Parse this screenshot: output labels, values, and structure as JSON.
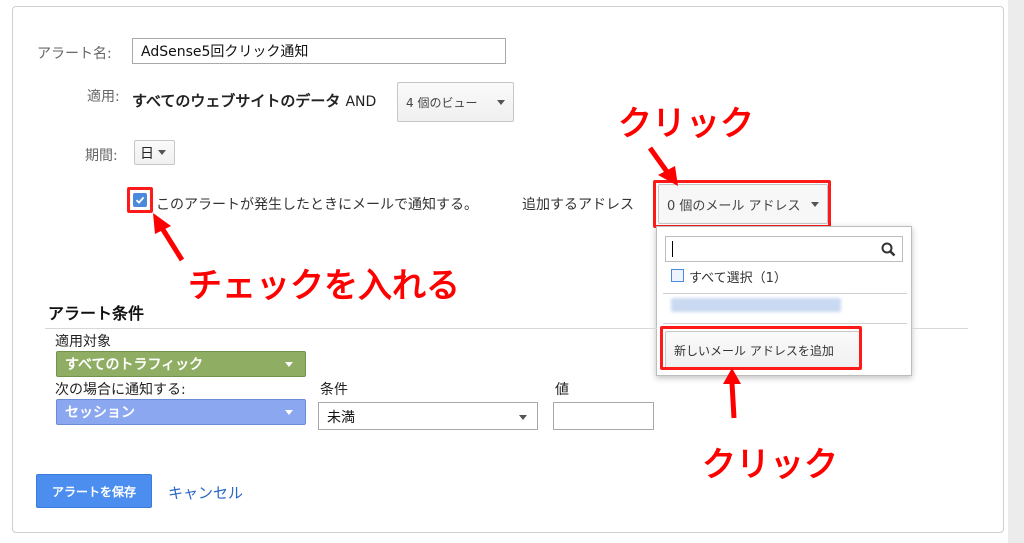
{
  "form": {
    "alert_name_label": "アラート名:",
    "alert_name_value": "AdSense5回クリック通知",
    "apply_label": "適用:",
    "apply_text": "すべてのウェブサイトのデータ",
    "apply_and": "AND",
    "views_button": "4 個のビュー",
    "period_label": "期間:",
    "period_value": "日",
    "email_checkbox_label": "このアラートが発生したときにメールで通知する。",
    "add_address_label": "追加するアドレス",
    "email_address_button": "0 個のメール アドレス"
  },
  "dropdown": {
    "select_all": "すべて選択（1）",
    "add_email_button": "新しいメール アドレスを追加"
  },
  "conditions": {
    "title": "アラート条件",
    "applies_to_label": "適用対象",
    "traffic_button": "すべてのトラフィック",
    "notify_when_label": "次の場合に通知する:",
    "session_button": "セッション",
    "condition_label": "条件",
    "condition_value": "未満",
    "value_label": "値"
  },
  "actions": {
    "save": "アラートを保存",
    "cancel": "キャンセル"
  },
  "annotations": {
    "click_top": "クリック",
    "check_instruction": "チェックを入れる",
    "click_bottom": "クリック"
  },
  "colors": {
    "annotation_red": "#ff0000",
    "save_blue": "#4b8ef0",
    "traffic_green": "#8fae64",
    "session_blue": "#8aa7f0",
    "link_blue": "#2a66c8"
  }
}
